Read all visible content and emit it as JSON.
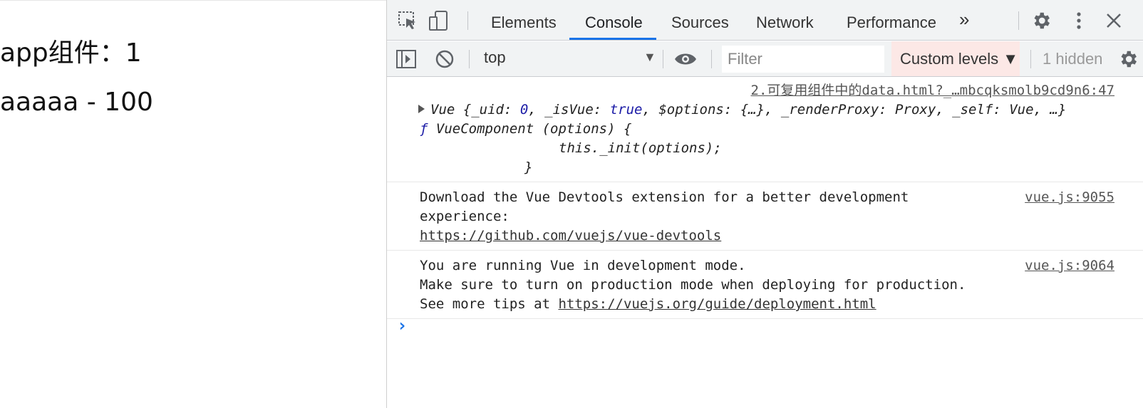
{
  "page": {
    "line1": "app组件：1",
    "line2": "aaaaa - 100"
  },
  "devtools": {
    "tabs": [
      "Elements",
      "Console",
      "Sources",
      "Network",
      "Performance"
    ],
    "active_tab": "Console",
    "more_tabs": "»",
    "context": "top",
    "filter_placeholder": "Filter",
    "levels_label": "Custom levels ▼",
    "hidden_count": "1 hidden"
  },
  "console": {
    "messages": [
      {
        "source": "2.可复用组件中的data.html?_…mbcqksmolb9cd9n6:47",
        "obj_line": "Vue {_uid: 0, _isVue: true, $options: {…}, _renderProxy: Proxy, _self: Vue, …}",
        "obj_prefix": "Vue {_uid: ",
        "obj_uid": "0",
        "obj_mid": ", _isVue: ",
        "obj_true": "true",
        "obj_suffix": ", $options: {…}, _renderProxy: Proxy, _self: Vue, …}",
        "fn_f": "ƒ",
        "fn_line1": " VueComponent (options) {",
        "fn_line2": "this._init(options);",
        "fn_line3": "}"
      },
      {
        "source": "vue.js:9055",
        "text1": "Download the Vue Devtools extension for a better development",
        "text2": "experience:",
        "link": "https://github.com/vuejs/vue-devtools"
      },
      {
        "source": "vue.js:9064",
        "text1": "You are running Vue in development mode.",
        "text2": "Make sure to turn on production mode when deploying for production.",
        "text3": "See more tips at ",
        "link": "https://vuejs.org/guide/deployment.html"
      }
    ],
    "prompt": "›"
  },
  "colors": {
    "accent": "#1a73e8",
    "toolbar_bg": "#f1f3f4",
    "levels_bg": "#fce8e6"
  }
}
